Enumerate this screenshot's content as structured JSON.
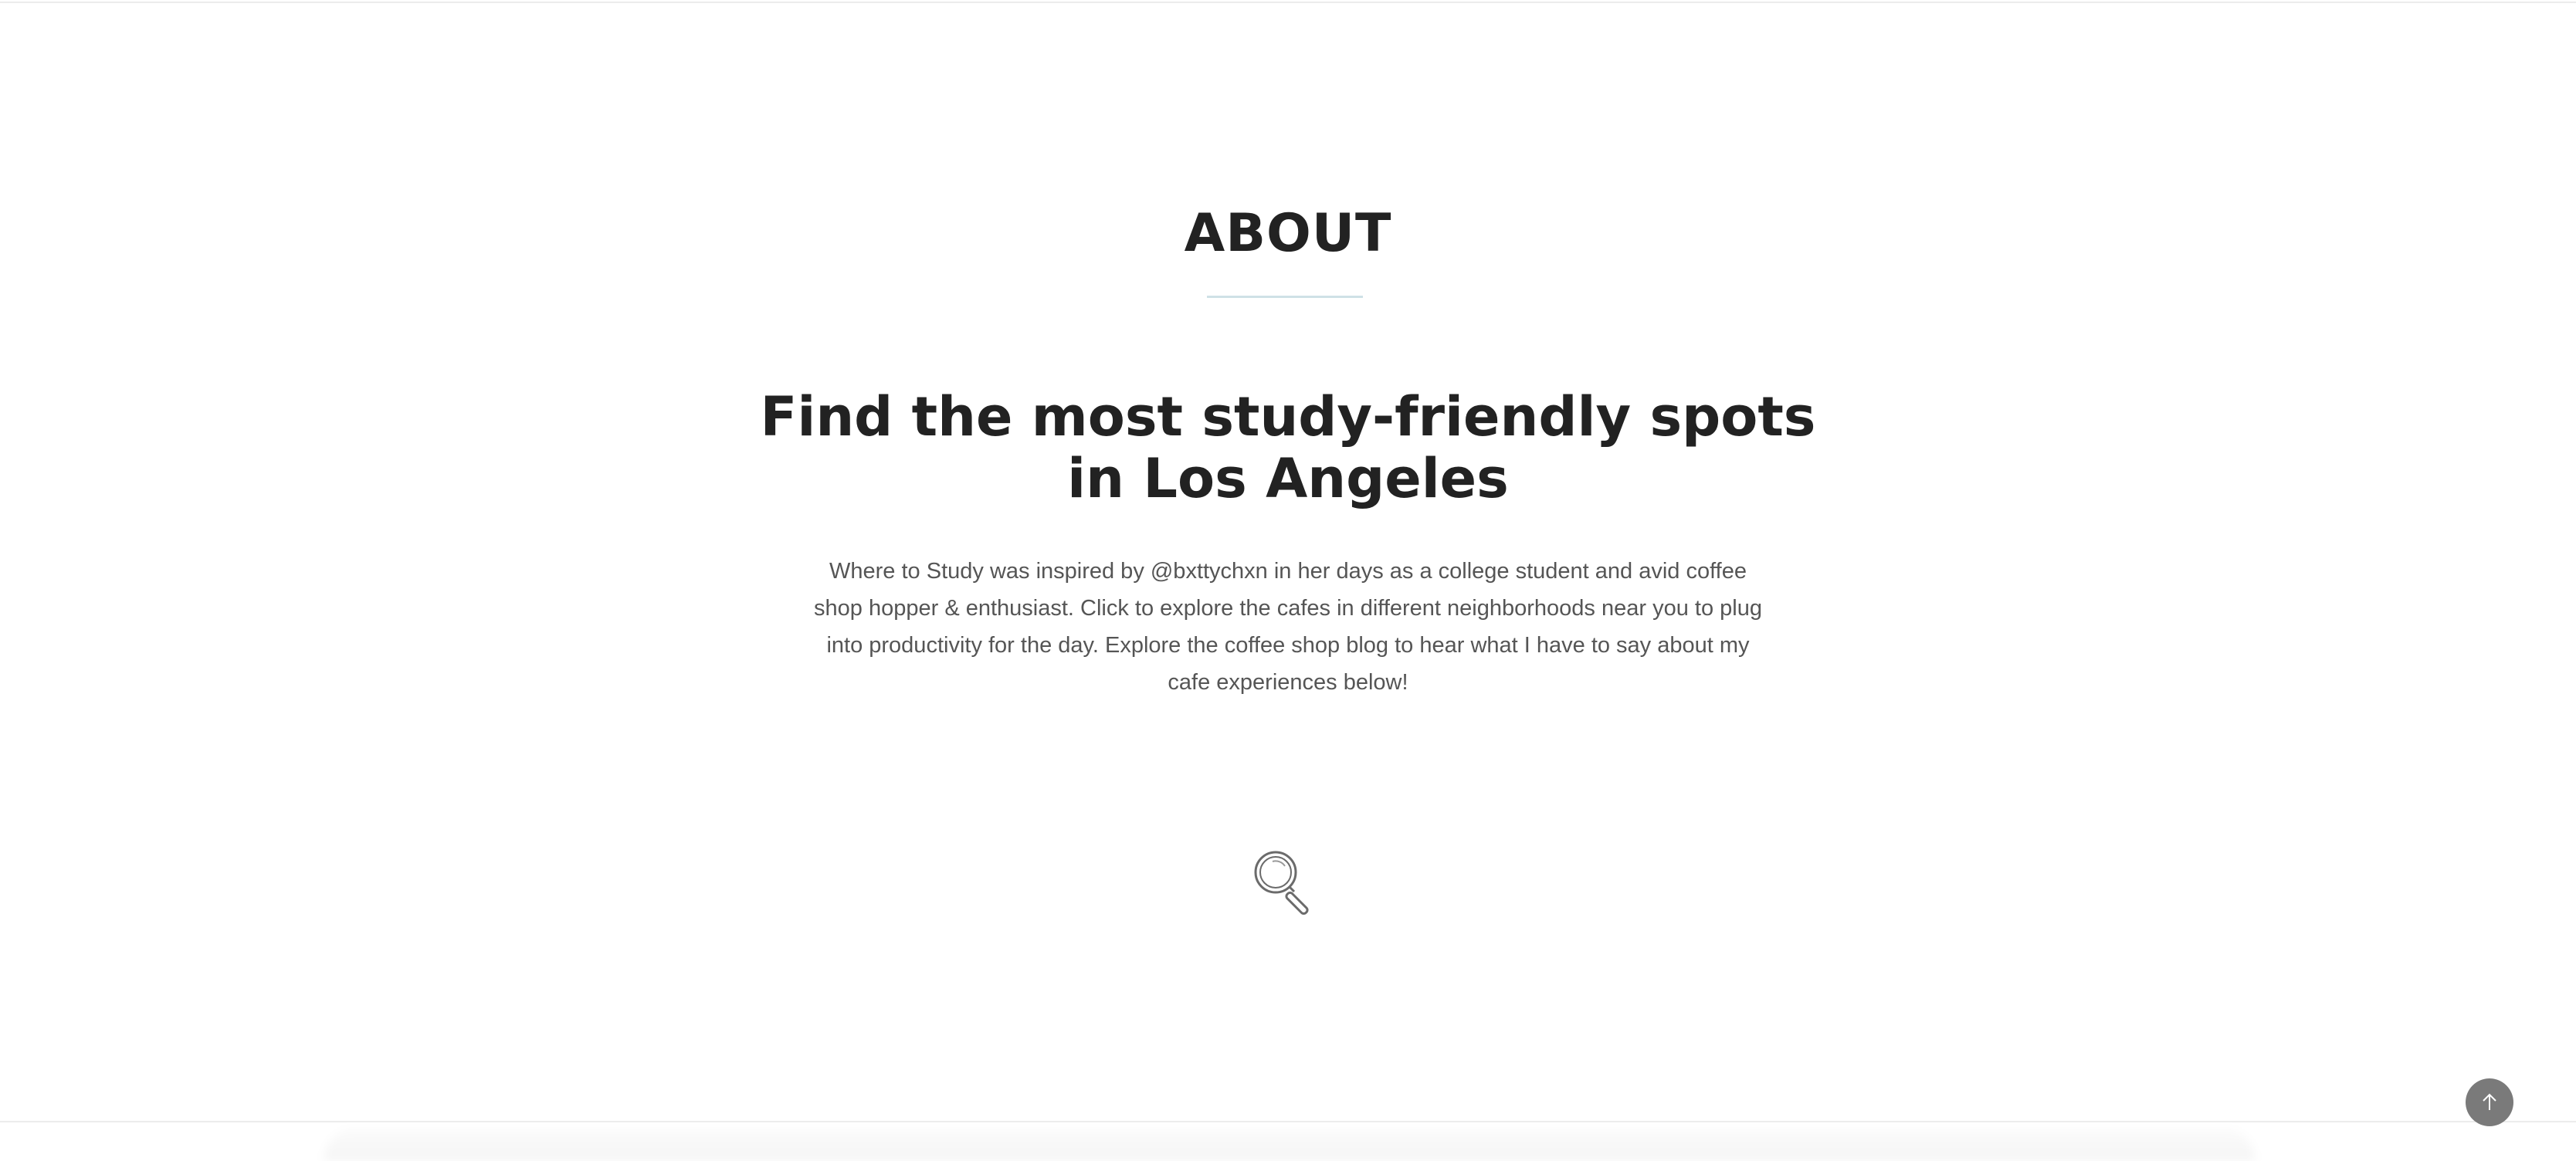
{
  "about": {
    "section_title": "ABOUT",
    "headline": "Find the most study-friendly spots in Los Angeles",
    "intro": "Where to Study was inspired by @bxttychxn in her days as a college student and avid coffee shop hopper & enthusiast. Click to explore the cafes in different neighborhoods near you to plug into productivity for the day. Explore the coffee shop blog to hear what I have to say about my cafe experiences below!"
  },
  "icons": {
    "search": "magnifying-glass-icon",
    "back_to_top": "arrow-up-icon"
  },
  "colors": {
    "heading": "#222222",
    "body_text": "#555555",
    "underline_accent": "#cfe1e6",
    "back_to_top_bg": "#7a7a7a"
  }
}
